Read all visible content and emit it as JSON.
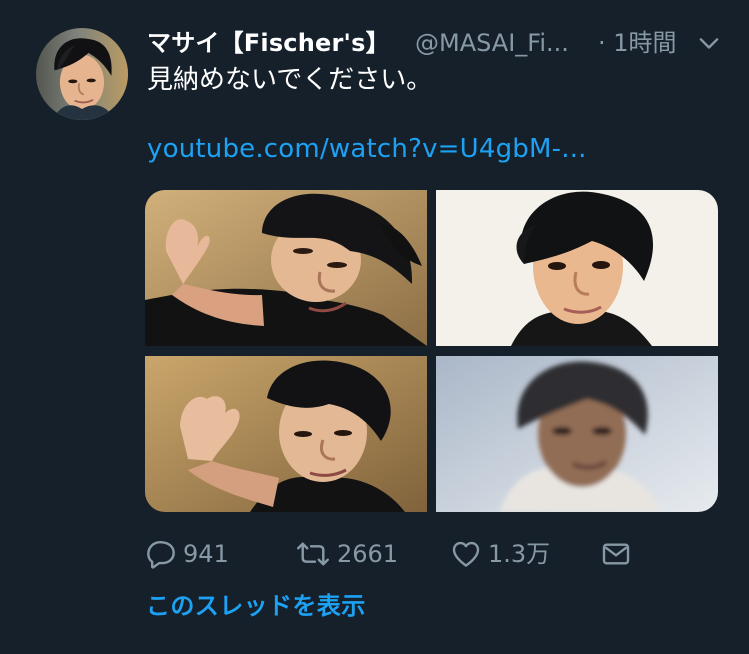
{
  "tweet": {
    "author": {
      "display_name": "マサイ【Fischer's】",
      "handle": "@MASAI_Fi...",
      "time": "· 1時間"
    },
    "text": "見納めないでください。",
    "link": "youtube.com/watch?v=U4gbM-...",
    "media": [
      {
        "name": "photo-lying-carpet-hand"
      },
      {
        "name": "photo-portrait-white-background"
      },
      {
        "name": "photo-lying-carpet-close"
      },
      {
        "name": "photo-blurry-portrait"
      }
    ],
    "actions": {
      "reply_count": "941",
      "retweet_count": "2661",
      "like_count": "1.3万",
      "share_icon": "mail-icon"
    },
    "thread_link": "このスレッドを表示"
  },
  "theme": {
    "background": "#15202b",
    "accent": "#1da1f2",
    "muted_text": "#8899a6",
    "primary_text": "#ffffff"
  },
  "icons": {
    "reply": "reply-icon",
    "retweet": "retweet-icon",
    "like": "heart-icon",
    "share": "mail-icon",
    "menu": "chevron-down-icon"
  }
}
